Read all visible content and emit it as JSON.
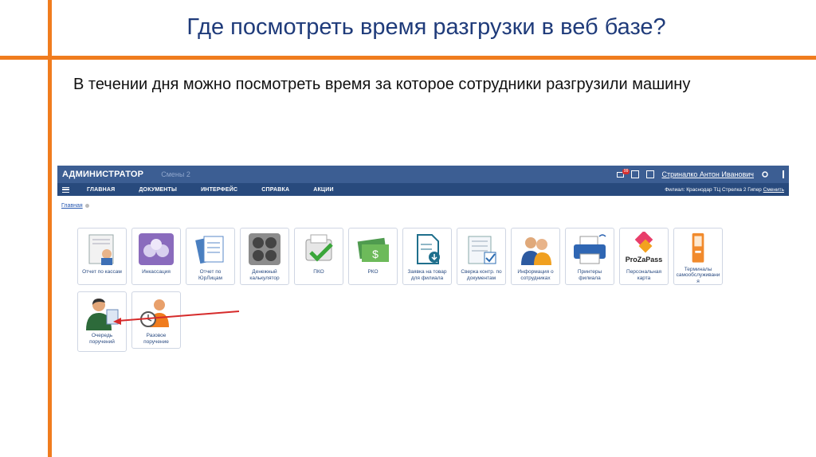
{
  "slide": {
    "title": "Где посмотреть время разгрузки в веб базе?",
    "text": "В течении дня можно посмотреть время за которое сотрудники разгрузили машину"
  },
  "app": {
    "role": "АДМИНИСТРАТОР",
    "shift": "Смены 2",
    "mail_badge": "99",
    "user_name": "Стриналко Антон Иванович",
    "nav": [
      "ГЛАВНАЯ",
      "ДОКУМЕНТЫ",
      "ИНТЕРФЕЙС",
      "СПРАВКА",
      "АКЦИИ"
    ],
    "branch": "Филиал: Краснодар ТЦ Стрелка 2 Гипер",
    "branch_change": "Сменить",
    "breadcrumb": "Главная",
    "tiles": [
      {
        "label": "Отчет по кассам",
        "icon": "cash-report-icon"
      },
      {
        "label": "Инкассация",
        "icon": "money-bags-icon"
      },
      {
        "label": "Отчет по ЮрЛицам",
        "icon": "documents-icon"
      },
      {
        "label": "Денежный калькулятор",
        "icon": "calculator-icon"
      },
      {
        "label": "ПКО",
        "icon": "cash-register-check-icon"
      },
      {
        "label": "РКО",
        "icon": "cash-money-icon"
      },
      {
        "label": "Заявка на товар для филиала",
        "icon": "file-download-icon"
      },
      {
        "label": "Сверка контр. по документам",
        "icon": "document-check-icon"
      },
      {
        "label": "Информация о сотрудниках",
        "icon": "employees-icon"
      },
      {
        "label": "Принтеры филиала",
        "icon": "printer-icon"
      },
      {
        "label": "Персональная карта",
        "icon": "prozapass-logo-icon",
        "logo_text": "ProZaPass"
      },
      {
        "label": "Терминалы самообслуживания",
        "icon": "self-service-terminal-icon"
      },
      {
        "label": "Очередь поручений",
        "icon": "task-queue-icon"
      },
      {
        "label": "Разовое поручение",
        "icon": "one-time-task-icon"
      }
    ]
  },
  "colors": {
    "accent": "#f07c1e",
    "title": "#1f3b7a",
    "topbar": "#3c5e93",
    "navbar": "#284a7d",
    "arrow": "#d62b2b"
  }
}
